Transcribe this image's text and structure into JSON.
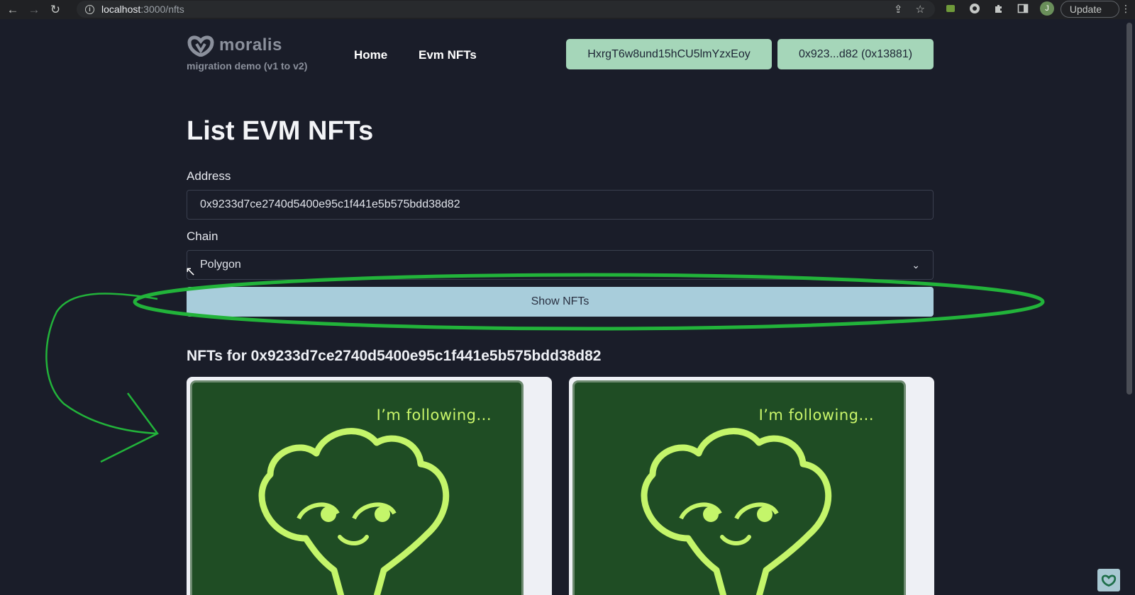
{
  "browser": {
    "url_host": "localhost",
    "url_path": ":3000/nfts",
    "update_label": "Update",
    "avatar_letter": "J"
  },
  "header": {
    "logo_text": "moralis",
    "logo_subtitle": "migration demo (v1 to v2)",
    "nav": [
      {
        "label": "Home"
      },
      {
        "label": "Evm NFTs"
      }
    ],
    "session_id": "HxrgT6w8und15hCU5lmYzxEoy",
    "wallet": "0x923...d82 (0x13881)"
  },
  "main": {
    "title": "List EVM NFTs",
    "address_label": "Address",
    "address_value": "0x9233d7ce2740d5400e95c1f441e5b575bdd38d82",
    "chain_label": "Chain",
    "chain_value": "Polygon",
    "show_button": "Show NFTs",
    "results_heading": "NFTs for 0x9233d7ce2740d5400e95c1f441e5b575bdd38d82",
    "nfts": [
      {
        "caption": "I’m following..."
      },
      {
        "caption": "I’m following..."
      }
    ]
  },
  "colors": {
    "background": "#1a1d29",
    "pill": "#a5d6b9",
    "button": "#a8cddb",
    "nft_bg": "#1f4d24",
    "nft_accent": "#c4f56a",
    "annotation": "#22b33a"
  }
}
